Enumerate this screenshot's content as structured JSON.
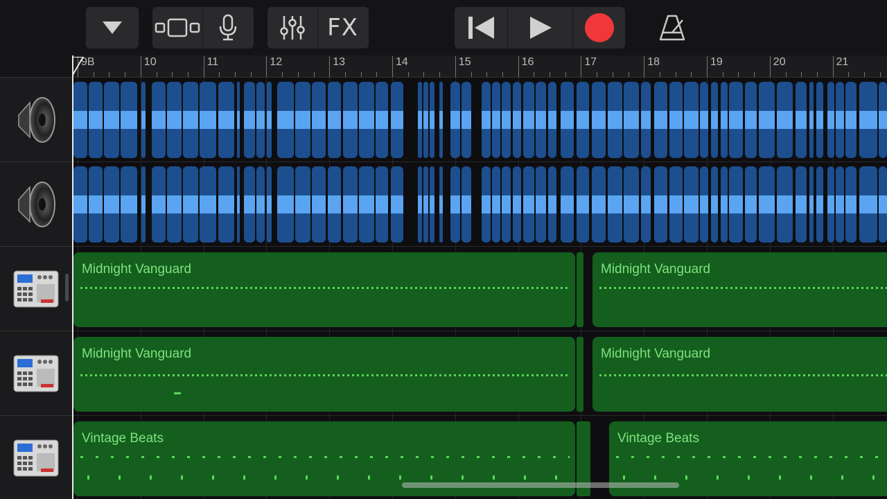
{
  "toolbar": {
    "browser_icon": "triangle-down-icon",
    "views_icon": "track-view-icon",
    "mic_icon": "microphone-icon",
    "mixer_icon": "sliders-icon",
    "fx_label": "FX",
    "transport": {
      "rewind_icon": "go-to-start-icon",
      "play_icon": "play-icon",
      "record_icon": "record-icon",
      "record_color": "#f0373a"
    },
    "metronome_icon": "metronome-icon"
  },
  "ruler": {
    "bars": [
      "9B",
      "10",
      "11",
      "12",
      "13",
      "14",
      "15",
      "16",
      "17",
      "18",
      "19",
      "20",
      "21"
    ]
  },
  "tracks": [
    {
      "type": "audio",
      "icon": "speaker-icon"
    },
    {
      "type": "audio",
      "icon": "speaker-icon"
    },
    {
      "type": "drum",
      "icon": "drum-machine-icon",
      "regions": [
        {
          "name": "Midnight Vanguard"
        },
        {
          "name": "Midnight Vanguard"
        }
      ]
    },
    {
      "type": "drum",
      "icon": "drum-machine-icon",
      "regions": [
        {
          "name": "Midnight Vanguard"
        },
        {
          "name": "Midnight Vanguard"
        }
      ]
    },
    {
      "type": "drum",
      "icon": "drum-machine-icon",
      "regions": [
        {
          "name": "Vintage Beats"
        },
        {
          "name": "Vintage Beats"
        }
      ]
    }
  ],
  "colors": {
    "audio_region": "#1d4f8f",
    "audio_wave": "#5aa4f2",
    "midi_region": "#145f1e",
    "midi_text": "#7ee27e"
  }
}
